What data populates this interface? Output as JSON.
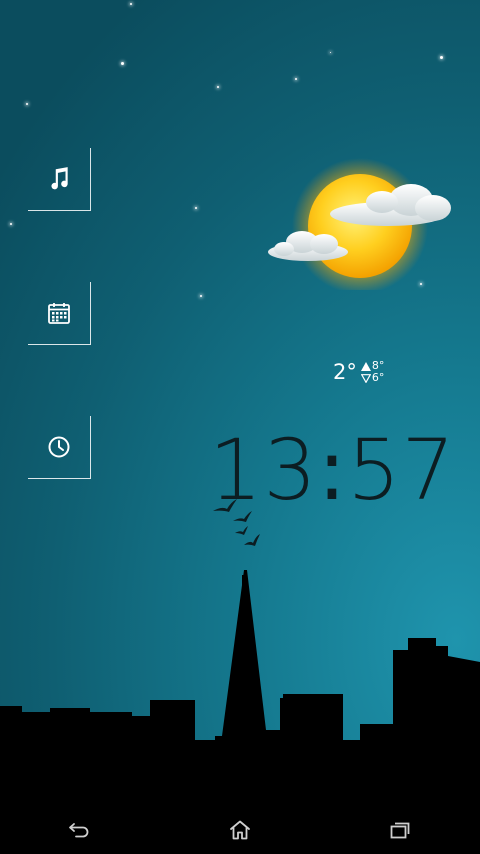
{
  "weather": {
    "current_temp": "2°",
    "high_temp": "8°",
    "low_temp": "6°",
    "condition_icon": "sun-with-clouds-icon"
  },
  "clock": {
    "hours": "13",
    "separator": ":",
    "minutes": "57"
  },
  "shortcuts": [
    {
      "icon": "music-note-icon"
    },
    {
      "icon": "calendar-icon"
    },
    {
      "icon": "clock-icon"
    }
  ],
  "navbar": {
    "buttons": [
      {
        "icon": "back-icon"
      },
      {
        "icon": "home-icon"
      },
      {
        "icon": "recent-apps-icon"
      }
    ]
  },
  "colors": {
    "sky_light": "#1f94ad",
    "sky_dark": "#0b4d5e",
    "clock_text": "#0c1d22",
    "silhouette": "#000000"
  }
}
